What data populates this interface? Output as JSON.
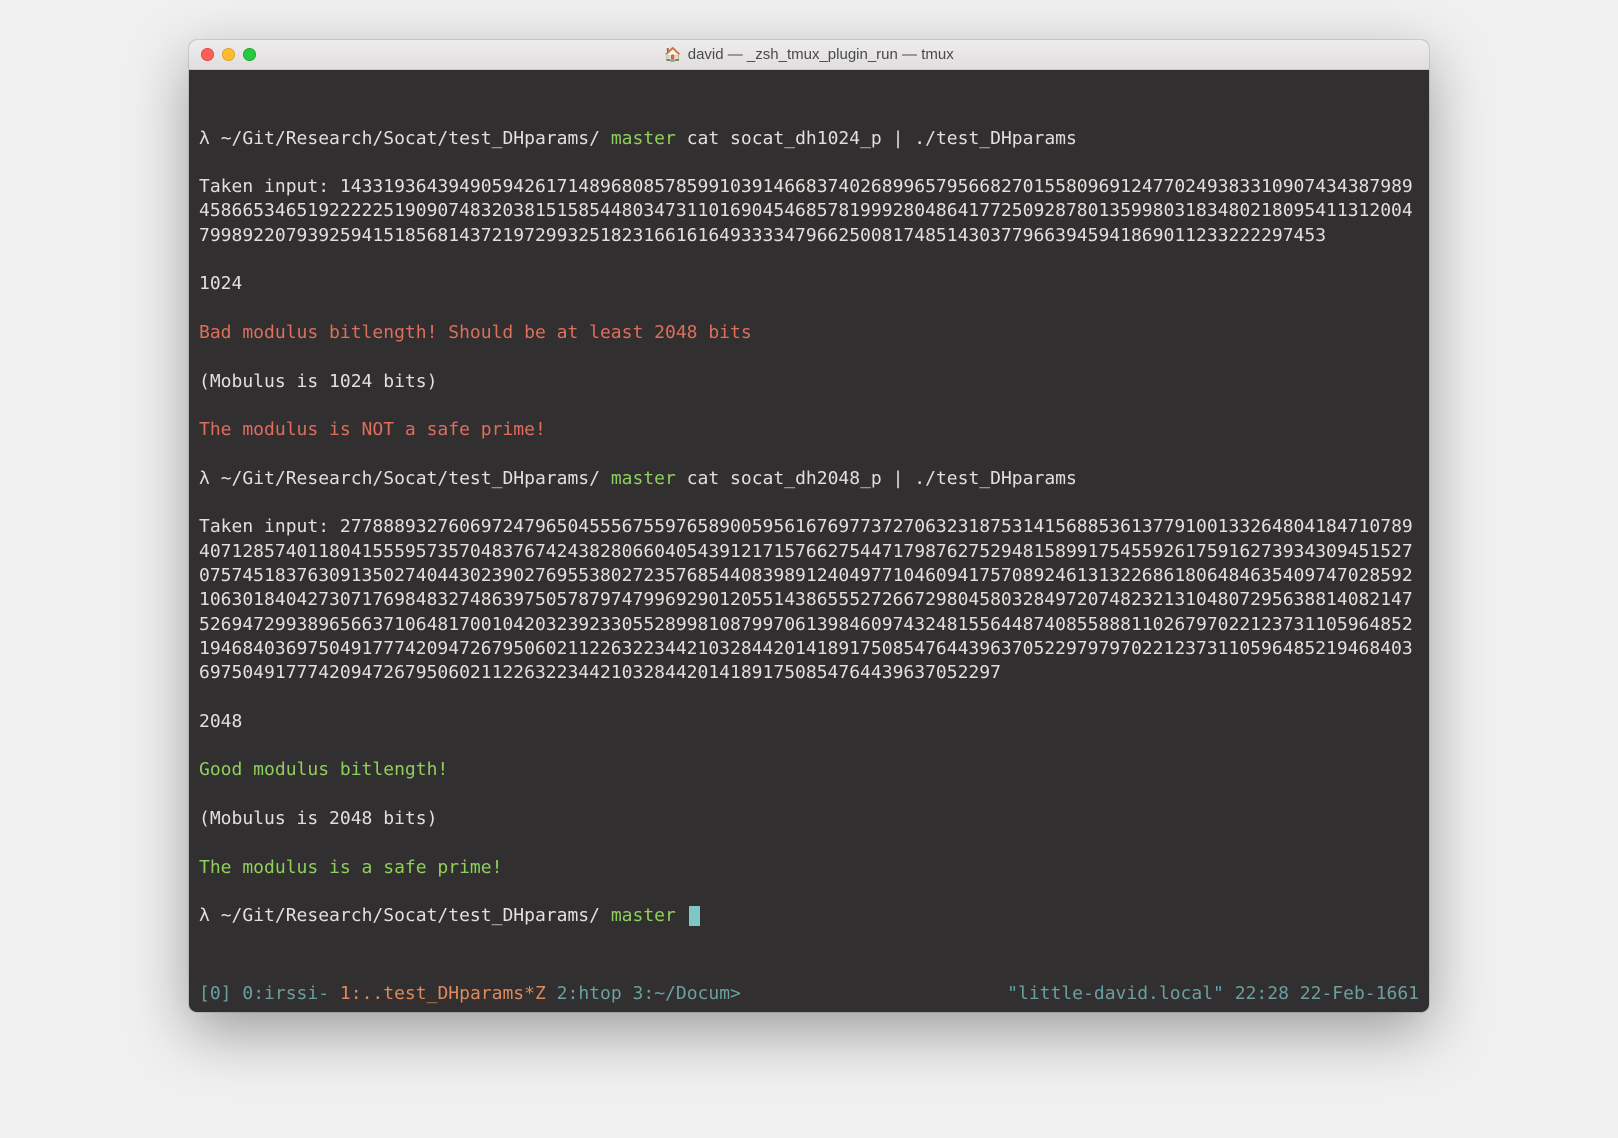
{
  "window": {
    "title": "david — _zsh_tmux_plugin_run — tmux"
  },
  "colors": {
    "bg": "#312f2f",
    "fg": "#e2e0dc",
    "branch": "#8fcf5c",
    "error": "#df6e5c",
    "ok": "#8fcf5c",
    "status": "#6aa0a0",
    "status_active": "#df8a5c"
  },
  "prompt": {
    "symbol": "λ",
    "path": "~/Git/Research/Socat/test_DHparams/",
    "branch": "master"
  },
  "run1": {
    "command": "cat socat_dh1024_p | ./test_DHparams",
    "taken_label": "Taken input:",
    "modulus": "143319364394905942617148968085785991039146683740268996579566827015580969124770249383310907434387989458665346519222225190907483203815158544803473110169045468578199928048641772509287801359980318348021809541131200479989220793925941518568143721972993251823166161649333347966250081748514303779663945941869011233222297453",
    "bits": "1024",
    "err_bitlength": "Bad modulus bitlength! Should be at least 2048 bits",
    "mobulus_note": "(Mobulus is 1024 bits)",
    "err_prime": "The modulus is NOT a safe prime!"
  },
  "run2": {
    "command": "cat socat_dh2048_p | ./test_DHparams",
    "taken_label": "Taken input:",
    "modulus": "2778889327606972479650455567559765890059561676977372706323187531415688536137791001332648041847107894071285740118041555957357048376742438280660405439121715766275447179876275294815899175455926175916273934309451527075745183763091350274044302390276955380272357685440839891240497710460941757089246131322686180648463540974702859210630184042730717698483274863975057879747996929012055143865552726672980458032849720748232131048072956388140821475269472993896566371064817001042032392330552899810879970613984609743248155644874085588811026797022123731105964852194684036975049177742094726795060211226322344210328442014189175085476443963705229797970221237311059648521946840369750491777420947267950602112263223442103284420141891750854764439637052297",
    "bits": "2048",
    "ok_bitlength": "Good modulus bitlength!",
    "mobulus_note": "(Mobulus is 2048 bits)",
    "ok_prime": "The modulus is a safe prime!"
  },
  "statusbar": {
    "prefix": "[0] ",
    "w0": "0:irssi-",
    "w1": "1:..test_DHparams*Z",
    "w2": "2:htop ",
    "w3": "3:~/Docum>",
    "host": "\"little-david.local\"",
    "time": "22:28",
    "date": "22-Feb-1661"
  }
}
